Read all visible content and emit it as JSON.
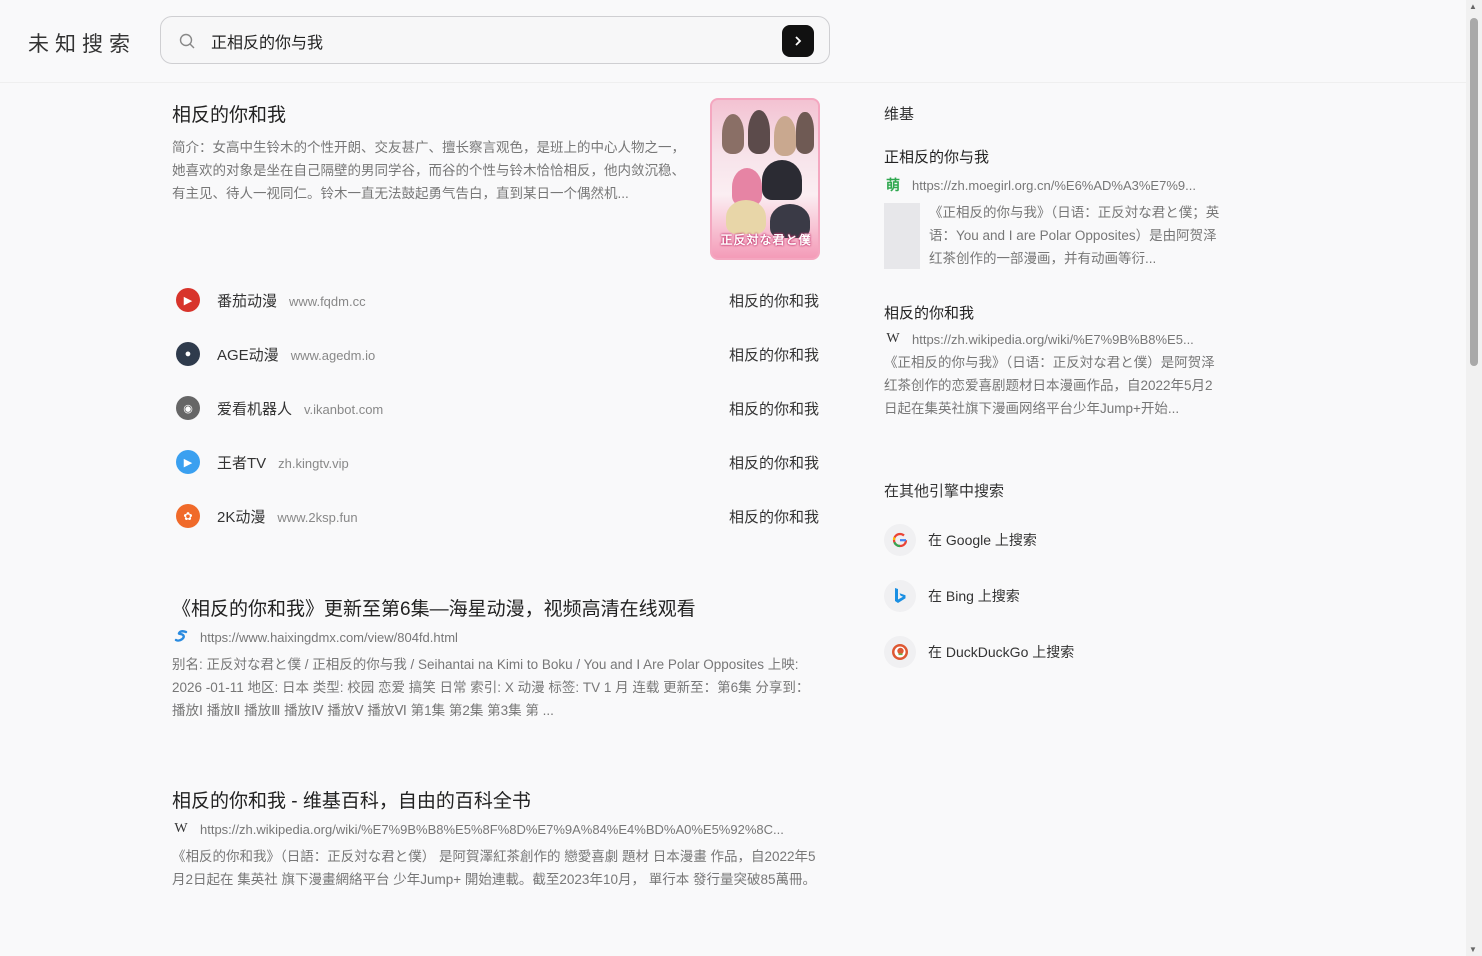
{
  "header": {
    "logo": "未知搜索",
    "search_value": "正相反的你与我"
  },
  "featured": {
    "title": "相反的你和我",
    "description": "简介：女高中生铃木的个性开朗、交友甚广、擅长察言观色，是班上的中心人物之一，她喜欢的对象是坐在自己隔壁的男同学谷，而谷的个性与铃木恰恰相反，他内敛沉稳、有主见、待人一视同仁。铃木一直无法鼓起勇气告白，直到某日一个偶然机...",
    "poster_caption": "正反対な君と僕"
  },
  "sources": [
    {
      "name": "番茄动漫",
      "host": "www.fqdm.cc",
      "title": "相反的你和我",
      "color": "#d8342b"
    },
    {
      "name": "AGE动漫",
      "host": "www.agedm.io",
      "title": "相反的你和我",
      "color": "#2f3b4c"
    },
    {
      "name": "爱看机器人",
      "host": "v.ikanbot.com",
      "title": "相反的你和我",
      "color": "#555555"
    },
    {
      "name": "王者TV",
      "host": "zh.kingtv.vip",
      "title": "相反的你和我",
      "color": "#3aa0f0"
    },
    {
      "name": "2K动漫",
      "host": "www.2ksp.fun",
      "title": "相反的你和我",
      "color": "#f06a2a"
    }
  ],
  "results": [
    {
      "title": "《相反的你和我》更新至第6集—海星动漫，视频高清在线观看",
      "url": "https://www.haixingdmx.com/view/804fd.html",
      "snippet": "别名: 正反対な君と僕 / 正相反的你与我 / Seihantai na Kimi to Boku / You and I Are Polar Opposites 上映: 2026 -01-11 地区: 日本 类型: 校园 恋爱 搞笑 日常 索引: X 动漫 标签: TV 1 月 连载 更新至：第6集 分享到： 播放Ⅰ 播放Ⅱ 播放Ⅲ 播放Ⅳ 播放Ⅴ 播放Ⅵ 第1集 第2集 第3集 第 ..."
    },
    {
      "title": "相反的你和我 - 维基百科，自由的百科全书",
      "url": "https://zh.wikipedia.org/wiki/%E7%9B%B8%E5%8F%8D%E7%9A%84%E4%BD%A0%E5%92%8C...",
      "snippet": "《相反的你和我》（日語：正反対な君と僕） 是阿賀澤紅茶創作的 戀愛喜劇 題材 日本漫畫 作品，自2022年5月2日起在 集英社 旗下漫畫網絡平台 少年Jump+ 開始連載。截至2023年10月， 單行本 發行量突破85萬冊。"
    }
  ],
  "sidebar": {
    "heading": "维基",
    "cards": [
      {
        "title": "正相反的你与我",
        "url": "https://zh.moegirl.org.cn/%E6%AD%A3%E7%9...",
        "fav": "萌",
        "text": "《正相反的你与我》（日语：正反対な君と僕；英语：You and I are Polar Opposites）是由阿贺泽红茶创作的一部漫画，并有动画等衍..."
      },
      {
        "title": "相反的你和我",
        "url": "https://zh.wikipedia.org/wiki/%E7%9B%B8%E5...",
        "fav": "W",
        "text": "《正相反的你与我》（日语：正反対な君と僕）是阿贺泽红茶创作的恋爱喜剧题材日本漫画作品，自2022年5月2日起在集英社旗下漫画网络平台少年Jump+开始..."
      }
    ],
    "other_heading": "在其他引擎中搜索",
    "engines": [
      {
        "label": "在 Google 上搜索",
        "icon": "google-icon"
      },
      {
        "label": "在 Bing 上搜索",
        "icon": "bing-icon"
      },
      {
        "label": "在 DuckDuckGo 上搜索",
        "icon": "duckduckgo-icon"
      }
    ]
  }
}
